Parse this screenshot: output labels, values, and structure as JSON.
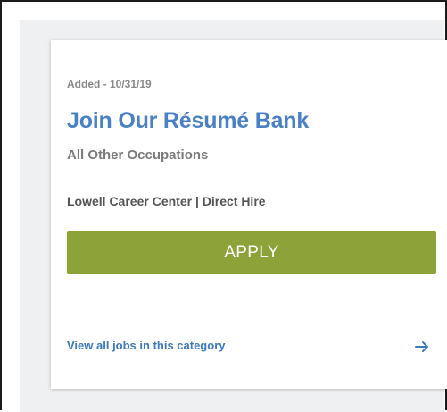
{
  "card": {
    "added_date": "Added - 10/31/19",
    "title": "Join Our Résumé Bank",
    "occupation": "All Other Occupations",
    "employer": "Lowell Career Center | Direct Hire",
    "apply_label": "APPLY",
    "view_link": "View all jobs in this category",
    "arrow_icon": "arrow-right-icon"
  },
  "colors": {
    "title": "#4a80c4",
    "apply_bg": "#8ea23a",
    "link": "#3d79be",
    "panel_bg": "#eef0f2"
  }
}
